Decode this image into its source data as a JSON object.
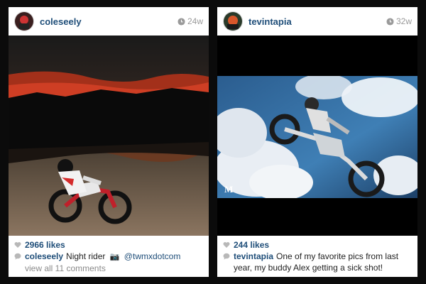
{
  "posts": [
    {
      "username": "coleseely",
      "time": "24w",
      "likes": "2966 likes",
      "caption_user": "coleseely",
      "caption_text": "Night rider",
      "caption_emoji": "📷",
      "caption_mention": "@twmxdotcom",
      "view_comments": "view all 11 comments"
    },
    {
      "username": "tevintapia",
      "time": "32w",
      "likes": "244 likes",
      "caption_user": "tevintapia",
      "caption_text": "One of my favorite pics from last year, my buddy Alex getting a sick shot!",
      "watermark": "M"
    }
  ],
  "icons": {
    "clock": "clock-icon",
    "heart": "heart-icon",
    "comment": "comment-bubble-icon",
    "camera": "camera-emoji"
  },
  "colors": {
    "username": "#1f4e79",
    "time": "#9a9a9a",
    "background": "#0b0b0b"
  }
}
